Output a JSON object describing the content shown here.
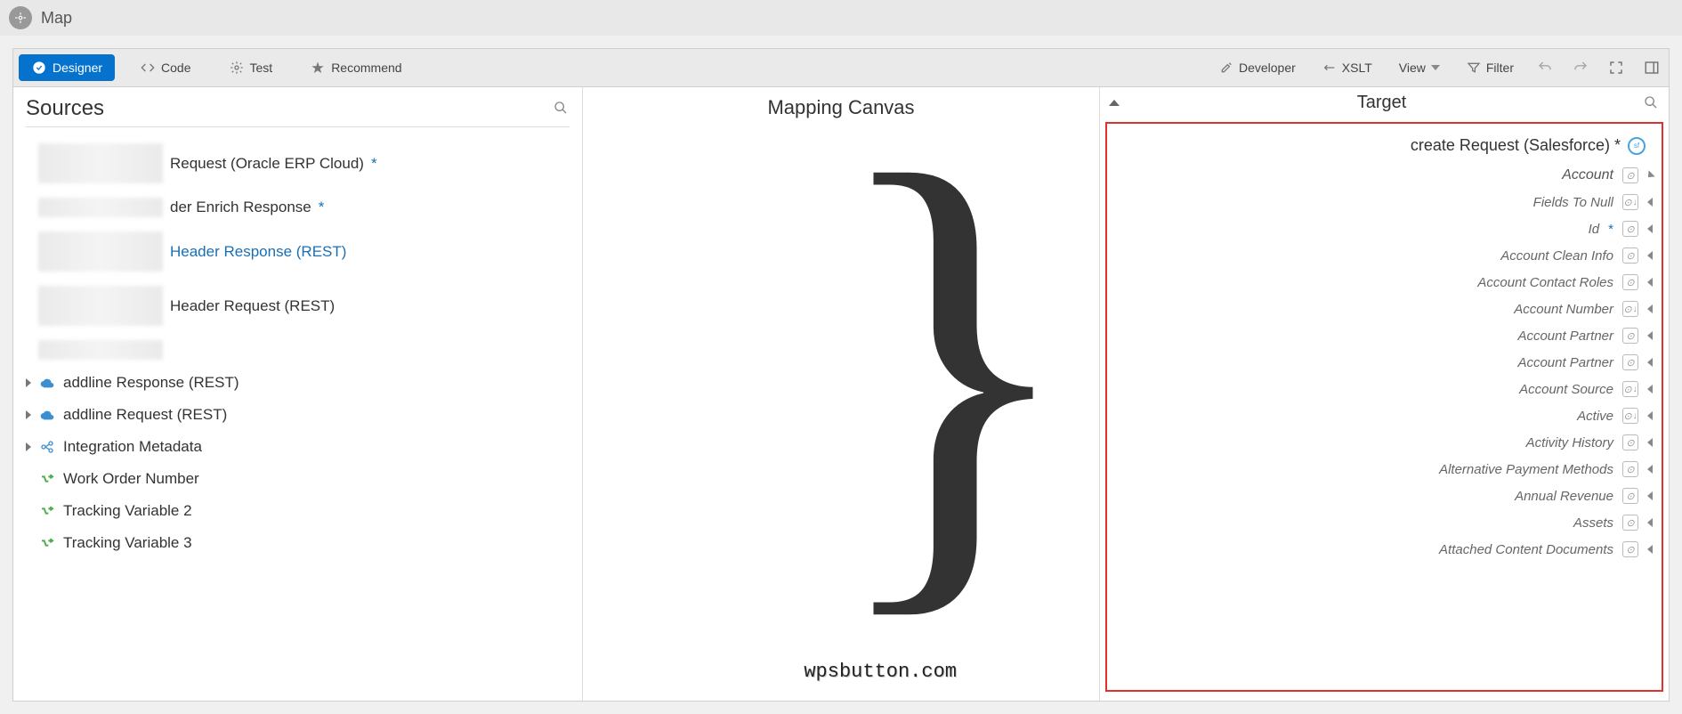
{
  "titlebar": {
    "title": "Map"
  },
  "toolbar": {
    "tabs": [
      {
        "label": "Designer",
        "active": true
      },
      {
        "label": "Code"
      },
      {
        "label": "Test"
      },
      {
        "label": "Recommend"
      }
    ],
    "right": {
      "developer": "Developer",
      "xslt": "XSLT",
      "view": "View",
      "filter": "Filter"
    }
  },
  "sources": {
    "title": "Sources",
    "items": [
      {
        "label": "Request (Oracle ERP Cloud)",
        "star": true,
        "blurred": true
      },
      {
        "label": "der Enrich Response",
        "star": true,
        "blurred": true,
        "small": true
      },
      {
        "label": "Header Response (REST)",
        "link": true,
        "blurred": true
      },
      {
        "label": "Header Request (REST)",
        "blurred": true
      },
      {
        "label": "",
        "blurred": true,
        "small": true,
        "nolabel": true
      },
      {
        "label": "addline Response (REST)",
        "icon": "cloud",
        "expandable": true
      },
      {
        "label": "addline Request (REST)",
        "icon": "cloud",
        "expandable": true
      },
      {
        "label": "Integration Metadata",
        "icon": "meta",
        "expandable": true
      },
      {
        "label": "Work Order Number",
        "icon": "var"
      },
      {
        "label": "Tracking Variable 2",
        "icon": "var"
      },
      {
        "label": "Tracking Variable 3",
        "icon": "var"
      }
    ]
  },
  "canvas": {
    "title": "Mapping Canvas"
  },
  "watermark": "wpsbutton.com",
  "target": {
    "title": "Target",
    "root": {
      "label": "create Request (Salesforce)",
      "star": true
    },
    "account": "Account",
    "fields": [
      {
        "label": "Fields To Null",
        "arr": true
      },
      {
        "label": "Id",
        "required": true,
        "arr": false
      },
      {
        "label": "Account Clean Info"
      },
      {
        "label": "Account Contact Roles"
      },
      {
        "label": "Account Number",
        "arr": true
      },
      {
        "label": "Account Partner"
      },
      {
        "label": "Account Partner"
      },
      {
        "label": "Account Source",
        "arr": true
      },
      {
        "label": "Active",
        "arr": true
      },
      {
        "label": "Activity History"
      },
      {
        "label": "Alternative Payment Methods"
      },
      {
        "label": "Annual Revenue"
      },
      {
        "label": "Assets"
      },
      {
        "label": "Attached Content Documents"
      }
    ]
  }
}
